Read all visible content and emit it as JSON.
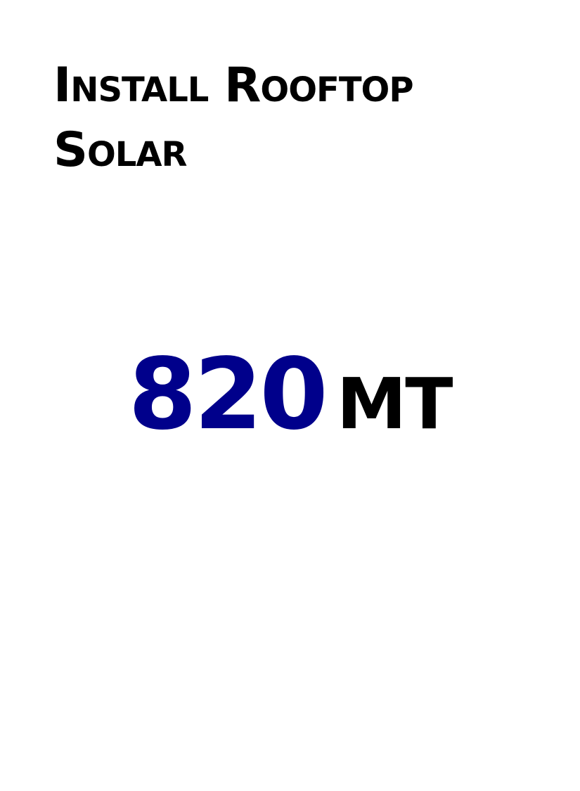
{
  "headline": "Install Rooftop Solar",
  "stat": {
    "value": "820",
    "unit": "MT"
  },
  "colors": {
    "value": "#00008b",
    "unit": "#000000",
    "headline": "#000000",
    "background": "#ffffff"
  }
}
